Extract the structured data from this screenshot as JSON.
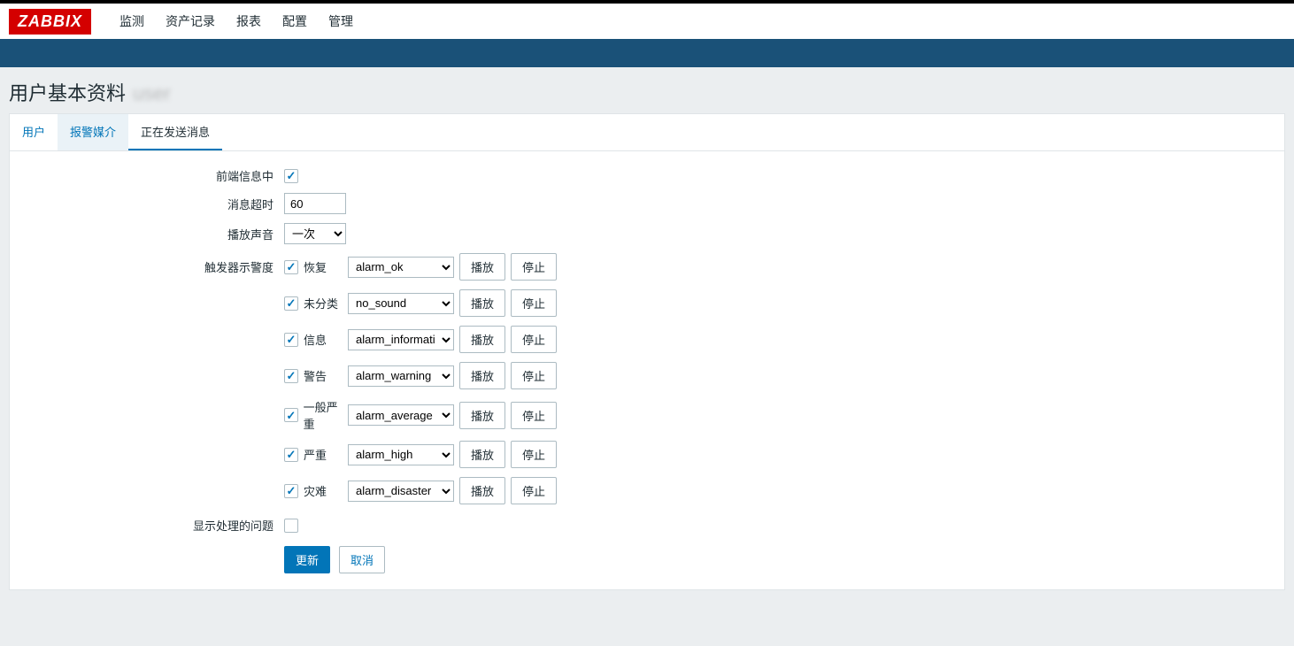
{
  "logo": "ZABBIX",
  "main_nav": [
    "监测",
    "资产记录",
    "报表",
    "配置",
    "管理"
  ],
  "page_title": "用户基本资料",
  "tabs": {
    "user": "用户",
    "media": "报警媒介",
    "messaging": "正在发送消息"
  },
  "form": {
    "frontend_messaging_label": "前端信息中",
    "frontend_messaging_checked": true,
    "message_timeout_label": "消息超时",
    "message_timeout_value": "60",
    "play_sound_label": "播放声音",
    "play_sound_value": "一次",
    "trigger_severity_label": "触发器示警度",
    "show_suppressed_label": "显示处理的问题",
    "show_suppressed_checked": false,
    "btn_play": "播放",
    "btn_stop": "停止",
    "btn_update": "更新",
    "btn_cancel": "取消",
    "severities": [
      {
        "label": "恢复",
        "checked": true,
        "sound": "alarm_ok"
      },
      {
        "label": "未分类",
        "checked": true,
        "sound": "no_sound"
      },
      {
        "label": "信息",
        "checked": true,
        "sound": "alarm_information"
      },
      {
        "label": "警告",
        "checked": true,
        "sound": "alarm_warning"
      },
      {
        "label": "一般严重",
        "checked": true,
        "sound": "alarm_average"
      },
      {
        "label": "严重",
        "checked": true,
        "sound": "alarm_high"
      },
      {
        "label": "灾难",
        "checked": true,
        "sound": "alarm_disaster"
      }
    ]
  }
}
